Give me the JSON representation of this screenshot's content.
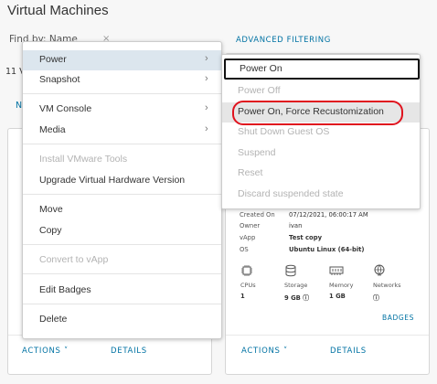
{
  "header": {
    "title": "Virtual Machines",
    "find_by": "Find by: Name",
    "clear_glyph": "×",
    "advanced_filtering": "ADVANCED FILTERING",
    "count_prefix": "11 V",
    "partial_letter": "N"
  },
  "context_menu": {
    "items": [
      {
        "label": "Power",
        "has_submenu": true,
        "state": "hover"
      },
      {
        "label": "Snapshot",
        "has_submenu": true
      },
      {
        "label": "VM Console",
        "has_submenu": true
      },
      {
        "label": "Media",
        "has_submenu": true
      },
      {
        "label": "Install VMware Tools",
        "disabled": true
      },
      {
        "label": "Upgrade Virtual Hardware Version"
      },
      {
        "label": "Move"
      },
      {
        "label": "Copy"
      },
      {
        "label": "Convert to vApp",
        "disabled": true
      },
      {
        "label": "Edit Badges"
      },
      {
        "label": "Delete"
      }
    ],
    "chevron": "›"
  },
  "power_submenu": {
    "items": [
      {
        "label": "Power On",
        "state": "focused"
      },
      {
        "label": "Power Off",
        "disabled": true
      },
      {
        "label": "Power On, Force Recustomization",
        "state": "hover",
        "highlighted": true
      },
      {
        "label": "Shut Down Guest OS",
        "disabled": true
      },
      {
        "label": "Suspend",
        "disabled": true
      },
      {
        "label": "Reset",
        "disabled": true
      },
      {
        "label": "Discard suspended state",
        "disabled": true
      }
    ],
    "highlight_color": "#e0131e"
  },
  "vm_card_right": {
    "details": [
      {
        "key": "Created On",
        "value": "07/12/2021, 06:00:17 AM"
      },
      {
        "key": "Owner",
        "value": "ivan"
      },
      {
        "key": "vApp",
        "value": "Test copy"
      },
      {
        "key": "OS",
        "value": "Ubuntu Linux (64-bit)"
      }
    ],
    "stats": [
      {
        "icon": "cpu-icon",
        "label": "CPUs",
        "value": "1"
      },
      {
        "icon": "storage-icon",
        "label": "Storage",
        "value": "9 GB ⓘ"
      },
      {
        "icon": "memory-icon",
        "label": "Memory",
        "value": "1 GB"
      },
      {
        "icon": "network-icon",
        "label": "Networks",
        "value": "ⓘ"
      }
    ],
    "badges_label": "BADGES",
    "actions_label": "ACTIONS ˅",
    "details_label": "DETAILS"
  },
  "vm_card_left": {
    "actions_label": "ACTIONS ˅",
    "details_label": "DETAILS"
  },
  "colors": {
    "link": "#0072a3",
    "menu_hover": "#dce6ee",
    "disabled_text": "#b3b3b3"
  }
}
